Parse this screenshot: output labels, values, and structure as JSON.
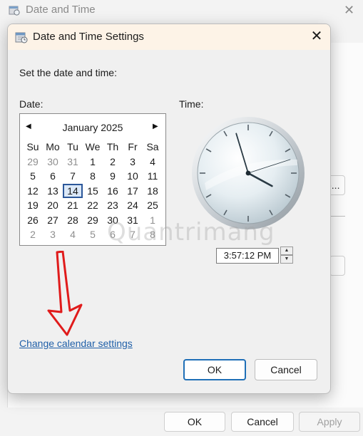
{
  "parent_window": {
    "title": "Date and Time",
    "partial_button_label": "e...",
    "buttons": {
      "ok": "OK",
      "cancel": "Cancel",
      "apply": "Apply"
    }
  },
  "dialog": {
    "title": "Date and Time Settings",
    "instruction": "Set the date and time:",
    "date_label": "Date:",
    "time_label": "Time:",
    "calendar": {
      "month": "January 2025",
      "weekdays": [
        "Su",
        "Mo",
        "Tu",
        "We",
        "Th",
        "Fr",
        "Sa"
      ],
      "weeks": [
        [
          {
            "d": "29",
            "o": true
          },
          {
            "d": "30",
            "o": true
          },
          {
            "d": "31",
            "o": true
          },
          {
            "d": "1"
          },
          {
            "d": "2"
          },
          {
            "d": "3"
          },
          {
            "d": "4"
          }
        ],
        [
          {
            "d": "5"
          },
          {
            "d": "6"
          },
          {
            "d": "7"
          },
          {
            "d": "8"
          },
          {
            "d": "9"
          },
          {
            "d": "10"
          },
          {
            "d": "11"
          }
        ],
        [
          {
            "d": "12"
          },
          {
            "d": "13"
          },
          {
            "d": "14",
            "sel": true
          },
          {
            "d": "15"
          },
          {
            "d": "16"
          },
          {
            "d": "17"
          },
          {
            "d": "18"
          }
        ],
        [
          {
            "d": "19"
          },
          {
            "d": "20"
          },
          {
            "d": "21"
          },
          {
            "d": "22"
          },
          {
            "d": "23"
          },
          {
            "d": "24"
          },
          {
            "d": "25"
          }
        ],
        [
          {
            "d": "26"
          },
          {
            "d": "27"
          },
          {
            "d": "28"
          },
          {
            "d": "29"
          },
          {
            "d": "30"
          },
          {
            "d": "31"
          },
          {
            "d": "1",
            "o": true
          }
        ],
        [
          {
            "d": "2",
            "o": true
          },
          {
            "d": "3",
            "o": true
          },
          {
            "d": "4",
            "o": true
          },
          {
            "d": "5",
            "o": true
          },
          {
            "d": "6",
            "o": true
          },
          {
            "d": "7",
            "o": true
          },
          {
            "d": "8",
            "o": true
          }
        ]
      ]
    },
    "clock": {
      "hours": 3,
      "minutes": 57,
      "seconds": 12
    },
    "time_value": "3:57:12 PM",
    "link_text": "Change calendar settings",
    "ok_label": "OK",
    "cancel_label": "Cancel"
  },
  "watermark": "Quantrimang",
  "colors": {
    "accent": "#1f6fb7",
    "link": "#1f5fa8",
    "arrow": "#e01b1b",
    "selected_day": "#2b579a"
  }
}
